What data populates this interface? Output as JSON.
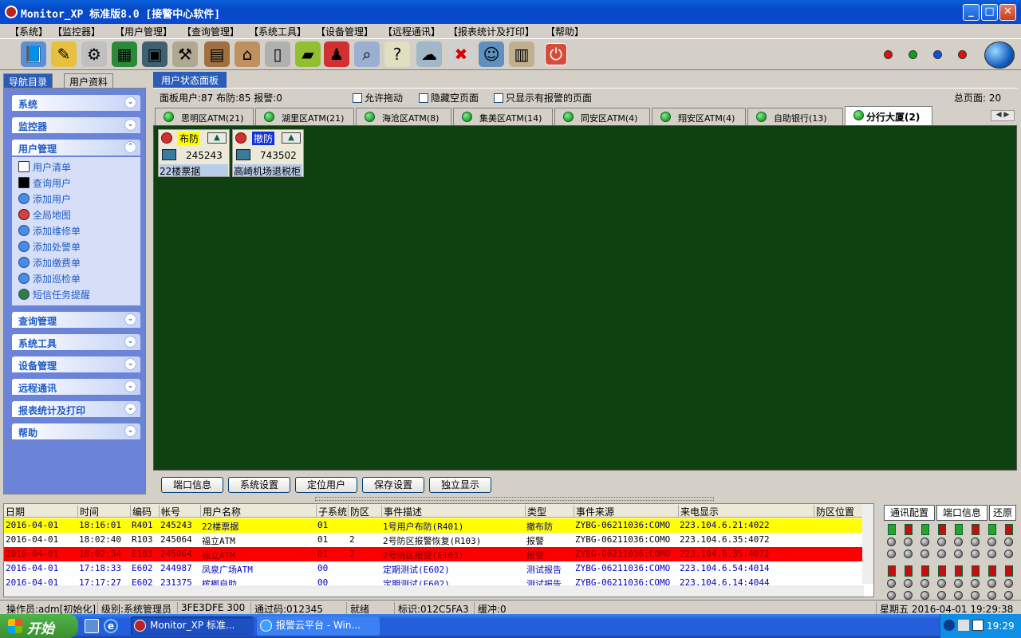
{
  "window": {
    "title": "Monitor_XP 标准版8.0 [接警中心软件]",
    "buttons": {
      "minimize": "_",
      "maximize": "□",
      "close": "✕"
    }
  },
  "menu": [
    "【系统】",
    "【监控器】",
    "【用户管理】",
    "【查询管理】",
    "【系统工具】",
    "【设备管理】",
    "【远程通讯】",
    "【报表统计及打印】",
    "【帮助】"
  ],
  "toolbar": {
    "icons": [
      "book-icon",
      "flag-pen-icon",
      "gears-icon",
      "computer-chart-icon",
      "monitor-user-icon",
      "tools-icon",
      "suitcase-lock-icon",
      "house-icon",
      "door-icon",
      "eraser-icon",
      "alarm-person-icon",
      "magnifier-icon",
      "help-doc-icon",
      "network-icon",
      "user-delete-icon",
      "users-icon",
      "stack-icon",
      "power-icon"
    ],
    "status_dots": [
      "#e01010",
      "#10a010",
      "#1050e0",
      "#e01010"
    ]
  },
  "nav": {
    "tabs": [
      "导航目录",
      "用户资料"
    ],
    "groups": {
      "system": "系统",
      "monitor": "监控器",
      "user_mgmt": "用户管理",
      "query_mgmt": "查询管理",
      "sys_tools": "系统工具",
      "device_mgmt": "设备管理",
      "remote": "远程通讯",
      "reports": "报表统计及打印",
      "help": "帮助"
    },
    "user_items": [
      "用户清单",
      "查询用户",
      "添加用户",
      "全局地图",
      "添加维修单",
      "添加处警单",
      "添加缴费单",
      "添加巡检单",
      "短信任务提醒"
    ]
  },
  "main": {
    "tab": "用户状态面板",
    "info": "面板用户:87 布防:85 报警:0",
    "options": [
      "允许拖动",
      "隐藏空页面",
      "只显示有报警的页面"
    ],
    "total_pages": "总页面: 20",
    "group_tabs": [
      "思明区ATM(21)",
      "湖里区ATM(21)",
      "海沧区ATM(8)",
      "集美区ATM(14)",
      "同安区ATM(4)",
      "翔安区ATM(4)",
      "自助银行(13)",
      "分行大厦(2)"
    ],
    "active_tab": "分行大厦(2)",
    "cards": [
      {
        "status": "布防",
        "status_color": "#ffff00",
        "account": "245243",
        "name": "22楼票据"
      },
      {
        "status": "撤防",
        "status_color": "#1030e0",
        "account": "743502",
        "name": "高崎机场退税柜"
      }
    ],
    "buttons": [
      "端口信息",
      "系统设置",
      "定位用户",
      "保存设置",
      "独立显示"
    ]
  },
  "events": {
    "columns": [
      "日期",
      "时间",
      "编码",
      "帐号",
      "用户名称",
      "子系统",
      "防区",
      "事件描述",
      "类型",
      "事件来源",
      "来电显示",
      "防区位置"
    ],
    "rows": [
      {
        "bg": "#ffff00",
        "fg": "#000080",
        "cells": [
          "2016-04-01",
          "18:16:01",
          "R401",
          "245243",
          "22楼票据",
          "01",
          "",
          "1号用户布防(R401)",
          "撤布防",
          "ZYBG-06211036:COMO",
          "223.104.6.21:4022",
          ""
        ]
      },
      {
        "bg": "#ffffff",
        "fg": "#000000",
        "cells": [
          "2016-04-01",
          "18:02:40",
          "R103",
          "245064",
          "福立ATM",
          "01",
          "2",
          "2号防区报警恢复(R103)",
          "报警",
          "ZYBG-06211036:COMO",
          "223.104.6.35:4072",
          ""
        ]
      },
      {
        "bg": "#ff0000",
        "fg": "#800000",
        "cells": [
          "2016-04-01",
          "18:02:34",
          "E103",
          "245064",
          "福立ATM",
          "01",
          "2",
          "2号防区报警(E103)",
          "报警",
          "ZYBG-06211036:COMO",
          "223.104.6.35:4072",
          ""
        ]
      },
      {
        "bg": "#ffffff",
        "fg": "#0000c0",
        "cells": [
          "2016-04-01",
          "17:18:33",
          "E602",
          "244987",
          "凤泉广场ATM",
          "00",
          "",
          "定期测试(E602)",
          "测试报告",
          "ZYBG-06211036:COMO",
          "223.104.6.54:4014",
          ""
        ]
      },
      {
        "bg": "#ffffff",
        "fg": "#0000c0",
        "cells": [
          "2016-04-01",
          "17:17:27",
          "E602",
          "231375",
          "槟榔自助",
          "00",
          "",
          "定期测试(E602)",
          "测试报告",
          "ZYBG-06211036:COMO",
          "223.104.6.14:4044",
          ""
        ]
      }
    ]
  },
  "io": {
    "buttons": [
      "通讯配置",
      "端口信息",
      "还原"
    ]
  },
  "status": {
    "operator": "操作员:adm[初始化]",
    "level": "级别:系统管理员",
    "code": "3FE3DFE 300",
    "auth": "通过码:012345",
    "state": "就绪",
    "id": "标识:012C5FA3",
    "buffer": "缓冲:0",
    "datetime": "星期五 2016-04-01 19:29:38"
  },
  "taskbar": {
    "start": "开始",
    "tasks": [
      "Monitor_XP 标准...",
      "报警云平台 - Win..."
    ],
    "clock": "19:29"
  }
}
